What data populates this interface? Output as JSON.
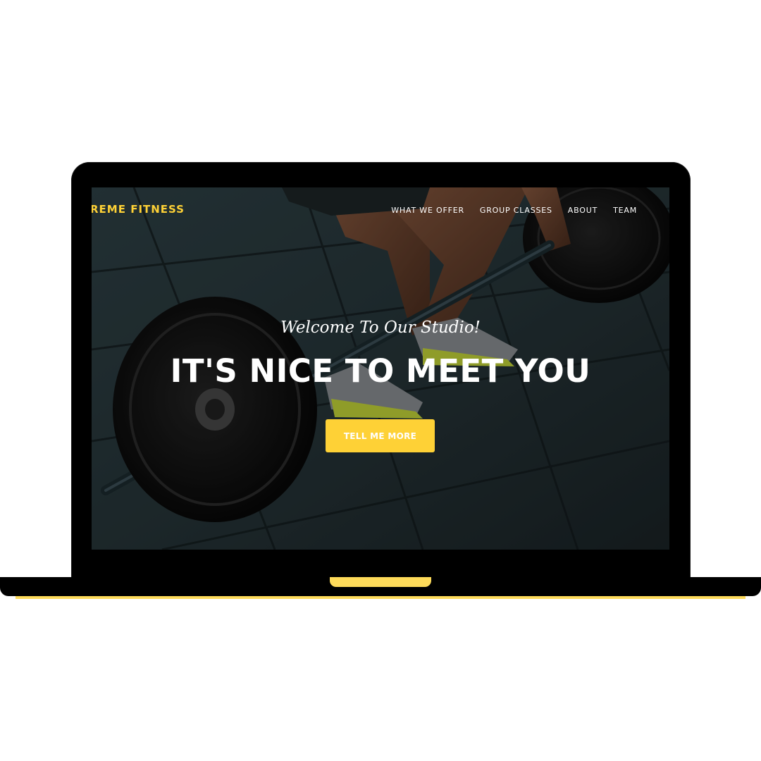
{
  "colors": {
    "accent": "#fed136",
    "base_accent": "#fedb5a",
    "laptop": "#000000",
    "background": "#ffffff"
  },
  "navbar": {
    "brand": "REME FITNESS",
    "links": [
      "WHAT WE OFFER",
      "GROUP CLASSES",
      "ABOUT",
      "TEAM"
    ]
  },
  "hero": {
    "subtitle": "Welcome To Our Studio!",
    "title": "IT'S NICE TO MEET YOU",
    "cta_label": "TELL ME MORE"
  },
  "icons": {
    "hero_image": "barbell-deadlift-photo"
  }
}
